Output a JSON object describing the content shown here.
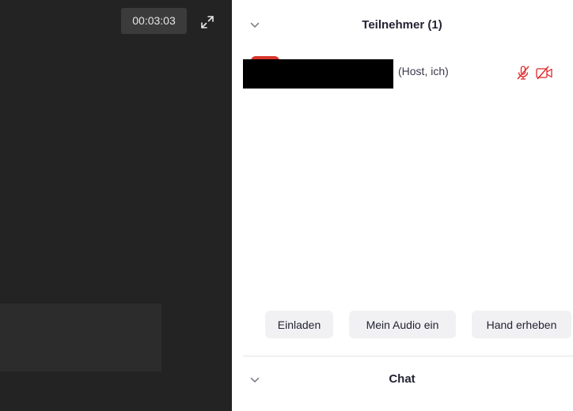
{
  "video": {
    "timer": "00:03:03",
    "expand_icon": "expand-icon"
  },
  "participants_panel": {
    "title": "Teilnehmer (1)",
    "chevron_icon": "chevron-down-icon",
    "participants": [
      {
        "name": "",
        "role": "(Host, ich)",
        "mic_icon": "microphone-muted-icon",
        "video_icon": "video-off-icon",
        "status_color": "#e02828"
      }
    ],
    "actions": {
      "invite": "Einladen",
      "unmute": "Mein Audio ein",
      "raise_hand": "Hand erheben"
    }
  },
  "chat_panel": {
    "title": "Chat",
    "chevron_icon": "chevron-down-icon"
  },
  "colors": {
    "video_background": "#232323",
    "muted_red": "#e02828",
    "avatar_red": "#d9342b"
  }
}
